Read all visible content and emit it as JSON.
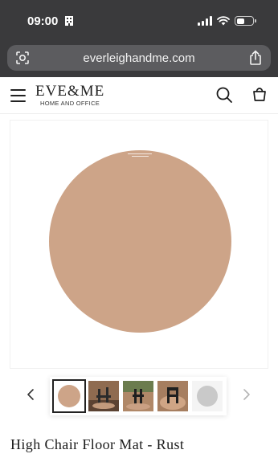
{
  "status_bar": {
    "time": "09:00",
    "icons": [
      "building-icon",
      "signal-icon",
      "wifi-icon",
      "battery-icon"
    ],
    "battery_level": 0.5
  },
  "browser": {
    "url": "everleighandme.com",
    "left_icon": "page-settings-icon",
    "right_icon": "share-icon"
  },
  "site_header": {
    "brand_name": "EVE&ME",
    "brand_tagline": "HOME AND OFFICE",
    "icons": [
      "menu-icon",
      "search-icon",
      "cart-bag-icon"
    ]
  },
  "product": {
    "title": "High Chair Floor Mat - Rust",
    "color": "#cda488",
    "gallery": {
      "prev_icon": "chevron-left-icon",
      "next_icon": "chevron-right-icon",
      "thumbnail_count": 5,
      "active_index": 0
    }
  }
}
